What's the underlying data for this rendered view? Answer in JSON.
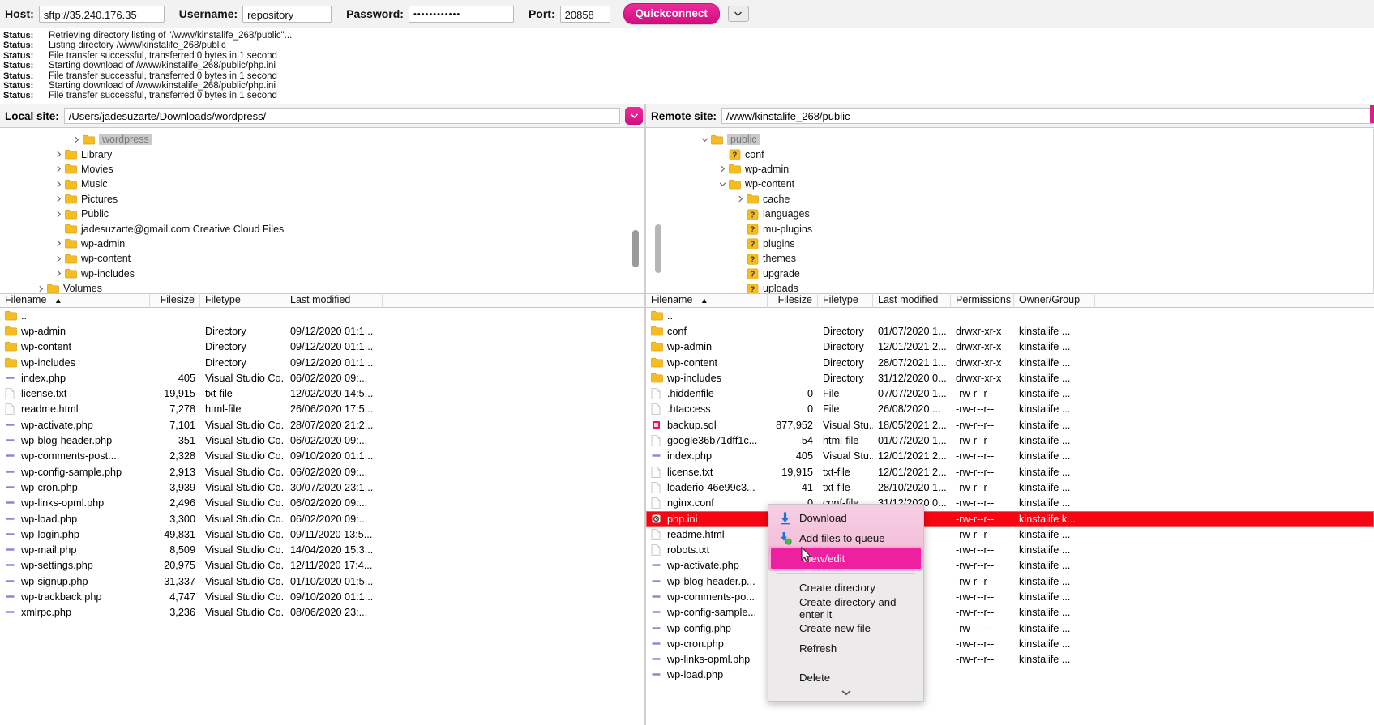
{
  "quickconnect": {
    "host_label": "Host:",
    "host_value": "sftp://35.240.176.35",
    "username_label": "Username:",
    "username_value": "repository",
    "password_label": "Password:",
    "password_value": "••••••••••••",
    "port_label": "Port:",
    "port_value": "20858",
    "button_label": "Quickconnect",
    "dropdown_icon": "chevron-down-icon",
    "accent_color": "#e01a8d"
  },
  "status_log": {
    "prefix": "Status:",
    "lines": [
      "Retrieving directory listing of \"/www/kinstalife_268/public\"...",
      "Listing directory /www/kinstalife_268/public",
      "File transfer successful, transferred 0 bytes in 1 second",
      "Starting download of /www/kinstalife_268/public/php.ini",
      "File transfer successful, transferred 0 bytes in 1 second",
      "Starting download of /www/kinstalife_268/public/php.ini",
      "File transfer successful, transferred 0 bytes in 1 second"
    ]
  },
  "local_panel": {
    "site_label": "Local site:",
    "site_path": "/Users/jadesuzarte/Downloads/wordpress/",
    "tree": [
      {
        "label": "wordpress",
        "depth": 3,
        "twist": "right",
        "selected": true
      },
      {
        "label": "Library",
        "depth": 2,
        "twist": "right",
        "selected": false
      },
      {
        "label": "Movies",
        "depth": 2,
        "twist": "right",
        "selected": false
      },
      {
        "label": "Music",
        "depth": 2,
        "twist": "right",
        "selected": false
      },
      {
        "label": "Pictures",
        "depth": 2,
        "twist": "right",
        "selected": false
      },
      {
        "label": "Public",
        "depth": 2,
        "twist": "right",
        "selected": false
      },
      {
        "label": "jadesuzarte@gmail.com Creative Cloud Files",
        "depth": 2,
        "twist": "none",
        "selected": false
      },
      {
        "label": "wp-admin",
        "depth": 2,
        "twist": "right",
        "selected": false
      },
      {
        "label": "wp-content",
        "depth": 2,
        "twist": "right",
        "selected": false
      },
      {
        "label": "wp-includes",
        "depth": 2,
        "twist": "right",
        "selected": false
      },
      {
        "label": "Volumes",
        "depth": 1,
        "twist": "right",
        "selected": false
      }
    ],
    "columns": [
      "Filename",
      "Filesize",
      "Filetype",
      "Last modified"
    ],
    "sort_indicator": "sort-asc-icon",
    "rows": [
      {
        "icon": "folder-icon",
        "name": "..",
        "size": "",
        "type": "",
        "modified": ""
      },
      {
        "icon": "folder-icon",
        "name": "wp-admin",
        "size": "",
        "type": "Directory",
        "modified": "09/12/2020 01:1..."
      },
      {
        "icon": "folder-icon",
        "name": "wp-content",
        "size": "",
        "type": "Directory",
        "modified": "09/12/2020 01:1..."
      },
      {
        "icon": "folder-icon",
        "name": "wp-includes",
        "size": "",
        "type": "Directory",
        "modified": "09/12/2020 01:1..."
      },
      {
        "icon": "php-file-icon",
        "name": "index.php",
        "size": "405",
        "type": "Visual Studio Co...",
        "modified": "06/02/2020 09:..."
      },
      {
        "icon": "blank-file-icon",
        "name": "license.txt",
        "size": "19,915",
        "type": "txt-file",
        "modified": "12/02/2020 14:5..."
      },
      {
        "icon": "blank-file-icon",
        "name": "readme.html",
        "size": "7,278",
        "type": "html-file",
        "modified": "26/06/2020 17:5..."
      },
      {
        "icon": "php-file-icon",
        "name": "wp-activate.php",
        "size": "7,101",
        "type": "Visual Studio Co...",
        "modified": "28/07/2020 21:2..."
      },
      {
        "icon": "php-file-icon",
        "name": "wp-blog-header.php",
        "size": "351",
        "type": "Visual Studio Co...",
        "modified": "06/02/2020 09:..."
      },
      {
        "icon": "php-file-icon",
        "name": "wp-comments-post....",
        "size": "2,328",
        "type": "Visual Studio Co...",
        "modified": "09/10/2020 01:1..."
      },
      {
        "icon": "php-file-icon",
        "name": "wp-config-sample.php",
        "size": "2,913",
        "type": "Visual Studio Co...",
        "modified": "06/02/2020 09:..."
      },
      {
        "icon": "php-file-icon",
        "name": "wp-cron.php",
        "size": "3,939",
        "type": "Visual Studio Co...",
        "modified": "30/07/2020 23:1..."
      },
      {
        "icon": "php-file-icon",
        "name": "wp-links-opml.php",
        "size": "2,496",
        "type": "Visual Studio Co...",
        "modified": "06/02/2020 09:..."
      },
      {
        "icon": "php-file-icon",
        "name": "wp-load.php",
        "size": "3,300",
        "type": "Visual Studio Co...",
        "modified": "06/02/2020 09:..."
      },
      {
        "icon": "php-file-icon",
        "name": "wp-login.php",
        "size": "49,831",
        "type": "Visual Studio Co...",
        "modified": "09/11/2020 13:5..."
      },
      {
        "icon": "php-file-icon",
        "name": "wp-mail.php",
        "size": "8,509",
        "type": "Visual Studio Co...",
        "modified": "14/04/2020 15:3..."
      },
      {
        "icon": "php-file-icon",
        "name": "wp-settings.php",
        "size": "20,975",
        "type": "Visual Studio Co...",
        "modified": "12/11/2020 17:4..."
      },
      {
        "icon": "php-file-icon",
        "name": "wp-signup.php",
        "size": "31,337",
        "type": "Visual Studio Co...",
        "modified": "01/10/2020 01:5..."
      },
      {
        "icon": "php-file-icon",
        "name": "wp-trackback.php",
        "size": "4,747",
        "type": "Visual Studio Co...",
        "modified": "09/10/2020 01:1..."
      },
      {
        "icon": "php-file-icon",
        "name": "xmlrpc.php",
        "size": "3,236",
        "type": "Visual Studio Co...",
        "modified": "08/06/2020 23:..."
      }
    ]
  },
  "remote_panel": {
    "site_label": "Remote site:",
    "site_path": "/www/kinstalife_268/public",
    "tree": [
      {
        "label": "public",
        "depth": 2,
        "twist": "down",
        "icon": "folder-icon",
        "selected": true
      },
      {
        "label": "conf",
        "depth": 3,
        "twist": "none",
        "icon": "unknown-folder-icon",
        "selected": false
      },
      {
        "label": "wp-admin",
        "depth": 3,
        "twist": "right",
        "icon": "folder-icon",
        "selected": false
      },
      {
        "label": "wp-content",
        "depth": 3,
        "twist": "down",
        "icon": "folder-icon",
        "selected": false
      },
      {
        "label": "cache",
        "depth": 4,
        "twist": "right",
        "icon": "folder-icon",
        "selected": false
      },
      {
        "label": "languages",
        "depth": 4,
        "twist": "none",
        "icon": "unknown-folder-icon",
        "selected": false
      },
      {
        "label": "mu-plugins",
        "depth": 4,
        "twist": "none",
        "icon": "unknown-folder-icon",
        "selected": false
      },
      {
        "label": "plugins",
        "depth": 4,
        "twist": "none",
        "icon": "unknown-folder-icon",
        "selected": false
      },
      {
        "label": "themes",
        "depth": 4,
        "twist": "none",
        "icon": "unknown-folder-icon",
        "selected": false
      },
      {
        "label": "upgrade",
        "depth": 4,
        "twist": "none",
        "icon": "unknown-folder-icon",
        "selected": false
      },
      {
        "label": "uploads",
        "depth": 4,
        "twist": "none",
        "icon": "unknown-folder-icon",
        "selected": false
      }
    ],
    "columns": [
      "Filename",
      "Filesize",
      "Filetype",
      "Last modified",
      "Permissions",
      "Owner/Group"
    ],
    "sort_indicator": "sort-asc-icon",
    "rows": [
      {
        "icon": "folder-icon",
        "name": "..",
        "size": "",
        "type": "",
        "modified": "",
        "perms": "",
        "owner": ""
      },
      {
        "icon": "folder-icon",
        "name": "conf",
        "size": "",
        "type": "Directory",
        "modified": "01/07/2020 1...",
        "perms": "drwxr-xr-x",
        "owner": "kinstalife ..."
      },
      {
        "icon": "folder-icon",
        "name": "wp-admin",
        "size": "",
        "type": "Directory",
        "modified": "12/01/2021 2...",
        "perms": "drwxr-xr-x",
        "owner": "kinstalife ..."
      },
      {
        "icon": "folder-icon",
        "name": "wp-content",
        "size": "",
        "type": "Directory",
        "modified": "28/07/2021 1...",
        "perms": "drwxr-xr-x",
        "owner": "kinstalife ..."
      },
      {
        "icon": "folder-icon",
        "name": "wp-includes",
        "size": "",
        "type": "Directory",
        "modified": "31/12/2020 0...",
        "perms": "drwxr-xr-x",
        "owner": "kinstalife ..."
      },
      {
        "icon": "blank-file-icon",
        "name": ".hiddenfile",
        "size": "0",
        "type": "File",
        "modified": "07/07/2020 1...",
        "perms": "-rw-r--r--",
        "owner": "kinstalife ..."
      },
      {
        "icon": "blank-file-icon",
        "name": ".htaccess",
        "size": "0",
        "type": "File",
        "modified": "26/08/2020 ...",
        "perms": "-rw-r--r--",
        "owner": "kinstalife ..."
      },
      {
        "icon": "sql-file-icon",
        "name": "backup.sql",
        "size": "877,952",
        "type": "Visual Stu...",
        "modified": "18/05/2021 2...",
        "perms": "-rw-r--r--",
        "owner": "kinstalife ..."
      },
      {
        "icon": "blank-file-icon",
        "name": "google36b71dff1c...",
        "size": "54",
        "type": "html-file",
        "modified": "01/07/2020 1...",
        "perms": "-rw-r--r--",
        "owner": "kinstalife ..."
      },
      {
        "icon": "php-file-icon",
        "name": "index.php",
        "size": "405",
        "type": "Visual Stu...",
        "modified": "12/01/2021 2...",
        "perms": "-rw-r--r--",
        "owner": "kinstalife ..."
      },
      {
        "icon": "blank-file-icon",
        "name": "license.txt",
        "size": "19,915",
        "type": "txt-file",
        "modified": "12/01/2021 2...",
        "perms": "-rw-r--r--",
        "owner": "kinstalife ..."
      },
      {
        "icon": "blank-file-icon",
        "name": "loaderio-46e99c3...",
        "size": "41",
        "type": "txt-file",
        "modified": "28/10/2020 1...",
        "perms": "-rw-r--r--",
        "owner": "kinstalife ..."
      },
      {
        "icon": "blank-file-icon",
        "name": "nginx.conf",
        "size": "0",
        "type": "conf-file",
        "modified": "31/12/2020 0...",
        "perms": "-rw-r--r--",
        "owner": "kinstalife ..."
      },
      {
        "icon": "ini-file-icon",
        "name": "php.ini",
        "size": "",
        "type": "",
        "modified": "021 1...",
        "perms": "-rw-r--r--",
        "owner": "kinstalife k...",
        "selected": true
      },
      {
        "icon": "blank-file-icon",
        "name": "readme.html",
        "size": "",
        "type": "",
        "modified": "21 2...",
        "perms": "-rw-r--r--",
        "owner": "kinstalife ..."
      },
      {
        "icon": "blank-file-icon",
        "name": "robots.txt",
        "size": "",
        "type": "",
        "modified": "021 2...",
        "perms": "-rw-r--r--",
        "owner": "kinstalife ..."
      },
      {
        "icon": "php-file-icon",
        "name": "wp-activate.php",
        "size": "",
        "type": "",
        "modified": "21 2...",
        "perms": "-rw-r--r--",
        "owner": "kinstalife ..."
      },
      {
        "icon": "php-file-icon",
        "name": "wp-blog-header.p...",
        "size": "",
        "type": "",
        "modified": "21 2...",
        "perms": "-rw-r--r--",
        "owner": "kinstalife ..."
      },
      {
        "icon": "php-file-icon",
        "name": "wp-comments-po...",
        "size": "",
        "type": "",
        "modified": "21 2...",
        "perms": "-rw-r--r--",
        "owner": "kinstalife ..."
      },
      {
        "icon": "php-file-icon",
        "name": "wp-config-sample...",
        "size": "",
        "type": "",
        "modified": "21 2...",
        "perms": "-rw-r--r--",
        "owner": "kinstalife ..."
      },
      {
        "icon": "php-file-icon",
        "name": "wp-config.php",
        "size": "",
        "type": "",
        "modified": "021 1...",
        "perms": "-rw-------",
        "owner": "kinstalife ..."
      },
      {
        "icon": "php-file-icon",
        "name": "wp-cron.php",
        "size": "",
        "type": "",
        "modified": "21 2...",
        "perms": "-rw-r--r--",
        "owner": "kinstalife ..."
      },
      {
        "icon": "php-file-icon",
        "name": "wp-links-opml.php",
        "size": "",
        "type": "",
        "modified": "21 2...",
        "perms": "-rw-r--r--",
        "owner": "kinstalife ..."
      },
      {
        "icon": "php-file-icon",
        "name": "wp-load.php",
        "size": "",
        "type": "",
        "modified": "21 2...",
        "perms": "",
        "owner": ""
      }
    ]
  },
  "context_menu": {
    "items": [
      {
        "label": "Download",
        "icon": "download-arrow-icon",
        "highlighted": false,
        "indent": false
      },
      {
        "label": "Add files to queue",
        "icon": "add-to-queue-icon",
        "highlighted": false,
        "indent": false
      },
      {
        "label": "View/edit",
        "icon": "none",
        "highlighted": true,
        "indent": true
      },
      {
        "separator": true
      },
      {
        "label": "Create directory",
        "icon": "none",
        "highlighted": false,
        "indent": true
      },
      {
        "label": "Create directory and enter it",
        "icon": "none",
        "highlighted": false,
        "indent": true
      },
      {
        "label": "Create new file",
        "icon": "none",
        "highlighted": false,
        "indent": true
      },
      {
        "label": "Refresh",
        "icon": "none",
        "highlighted": false,
        "indent": true
      },
      {
        "separator": true
      },
      {
        "label": "Delete",
        "icon": "none",
        "highlighted": false,
        "indent": true
      }
    ],
    "more_icon": "chevron-down-icon",
    "highlight_color": "#ee20a0"
  }
}
